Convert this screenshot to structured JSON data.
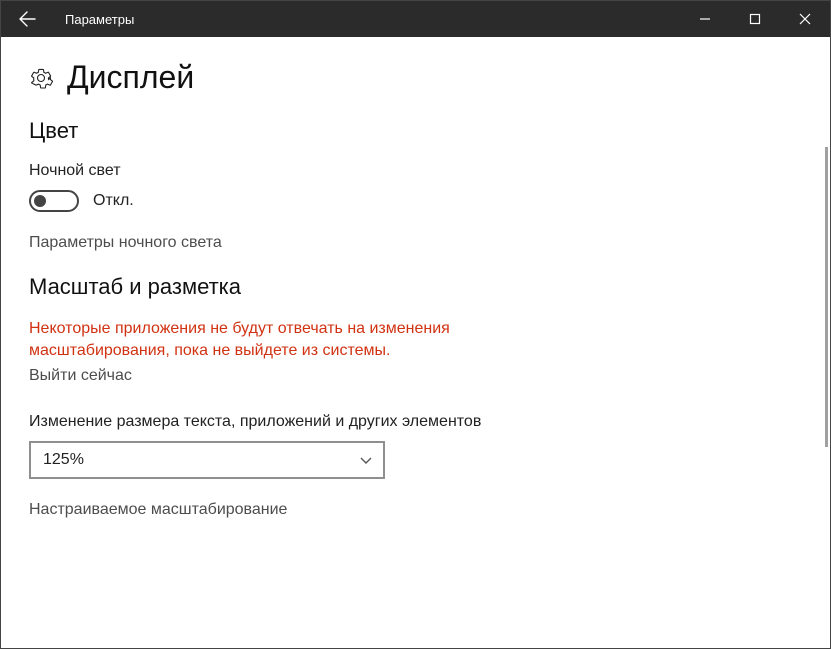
{
  "window": {
    "title": "Параметры"
  },
  "page": {
    "heading": "Дисплей"
  },
  "color": {
    "section_title": "Цвет",
    "night_light_label": "Ночной свет",
    "toggle_state": "Откл.",
    "night_light_settings": "Параметры ночного света"
  },
  "scale": {
    "section_title": "Масштаб и разметка",
    "warning": "Некоторые приложения не будут отвечать на изменения масштабирования, пока не выйдете из системы.",
    "sign_out_now": "Выйти сейчас",
    "resize_label": "Изменение размера текста, приложений и других элементов",
    "selected_value": "125%",
    "custom_scaling": "Настраиваемое масштабирование"
  }
}
